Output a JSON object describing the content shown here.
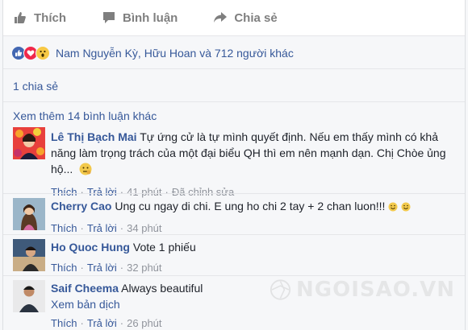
{
  "actions": {
    "like_label": "Thích",
    "comment_label": "Bình luận",
    "share_label": "Chia sẻ"
  },
  "reactions": {
    "icons": [
      "like-icon",
      "love-icon",
      "wow-icon"
    ],
    "text": "Nam Nguyễn Kỳ, Hữu Hoan và 712 người khác"
  },
  "shares": {
    "text": "1 chia sẻ"
  },
  "more_comments": {
    "text": "Xem thêm 14 bình luận khác"
  },
  "comments": [
    {
      "name": "Lê Thị Bạch Mai",
      "text": "Tự ứng cử là tự mình quyết định. Nếu em thấy mình có khả năng làm trọng trách của một đại biểu QH thì em nên mạnh dạn. Chị Chòe ủng hộ...",
      "like": "Thích",
      "reply": "Trả lời",
      "time": "41 phút",
      "edited": "Đã chỉnh sửa"
    },
    {
      "name": "Cherry Cao",
      "text": "Ung cu ngay di chi. E ung ho chi 2 tay + 2 chan luon!!!",
      "like": "Thích",
      "reply": "Trả lời",
      "time": "34 phút"
    },
    {
      "name": "Ho Quoc Hung",
      "text": "Vote 1 phiếu",
      "like": "Thích",
      "reply": "Trả lời",
      "time": "32 phút"
    },
    {
      "name": "Saif Cheema",
      "text": "Always beautiful",
      "translate": "Xem bản dịch",
      "like": "Thích",
      "reply": "Trả lời",
      "time": "26 phút"
    }
  ],
  "watermark": {
    "text": "NGOISAO.VN"
  },
  "colors": {
    "link": "#365899",
    "meta": "#90949c",
    "background": "#f6f7f9",
    "like_reaction": "#4267b2",
    "love_reaction": "#f0284a",
    "wow_reaction": "#f7c844"
  }
}
